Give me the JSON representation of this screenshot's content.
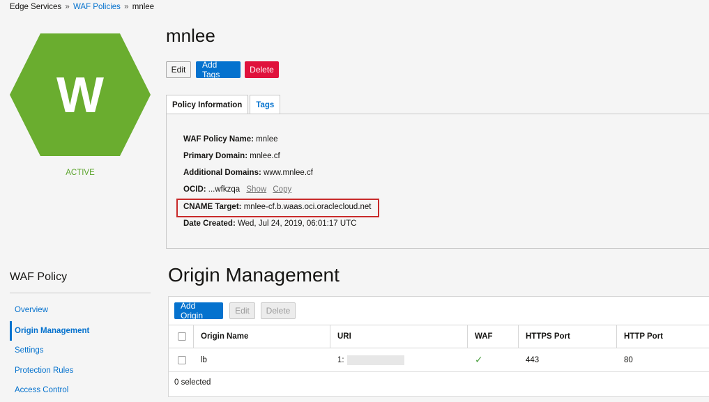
{
  "breadcrumb": {
    "root": "Edge Services",
    "sep1": "»",
    "parent": "WAF Policies",
    "sep2": "»",
    "current": "mnlee"
  },
  "resource": {
    "icon_letter": "W",
    "status": "ACTIVE",
    "status_color": "#5ba42c",
    "icon_color": "#6aad2f",
    "title": "mnlee"
  },
  "actions": {
    "edit": "Edit",
    "add_tags": "Add Tags",
    "delete": "Delete"
  },
  "tabs": [
    {
      "label": "Policy Information"
    },
    {
      "label": "Tags"
    }
  ],
  "info": {
    "policy_name_label": "WAF Policy Name:",
    "policy_name_value": "mnlee",
    "primary_domain_label": "Primary Domain:",
    "primary_domain_value": "mnlee.cf",
    "additional_domains_label": "Additional Domains:",
    "additional_domains_value": "www.mnlee.cf",
    "ocid_label": "OCID:",
    "ocid_value": "...wfkzqa",
    "ocid_show": "Show",
    "ocid_copy": "Copy",
    "cname_label": "CNAME Target:",
    "cname_value": "mnlee-cf.b.waas.oci.oraclecloud.net",
    "date_label": "Date Created:",
    "date_value": "Wed, Jul 24, 2019, 06:01:17 UTC"
  },
  "sidebar": {
    "title": "WAF Policy",
    "items": [
      {
        "label": "Overview"
      },
      {
        "label": "Origin Management"
      },
      {
        "label": "Settings"
      },
      {
        "label": "Protection Rules"
      },
      {
        "label": "Access Control"
      }
    ]
  },
  "origins": {
    "title": "Origin Management",
    "add_label": "Add Origin",
    "edit_label": "Edit",
    "delete_label": "Delete",
    "columns": [
      "Origin Name",
      "URI",
      "WAF",
      "HTTPS Port",
      "HTTP Port"
    ],
    "rows": [
      {
        "name": "lb",
        "uri": "1:",
        "waf": "✓",
        "https_port": "443",
        "http_port": "80"
      }
    ],
    "footer": "0 selected"
  }
}
